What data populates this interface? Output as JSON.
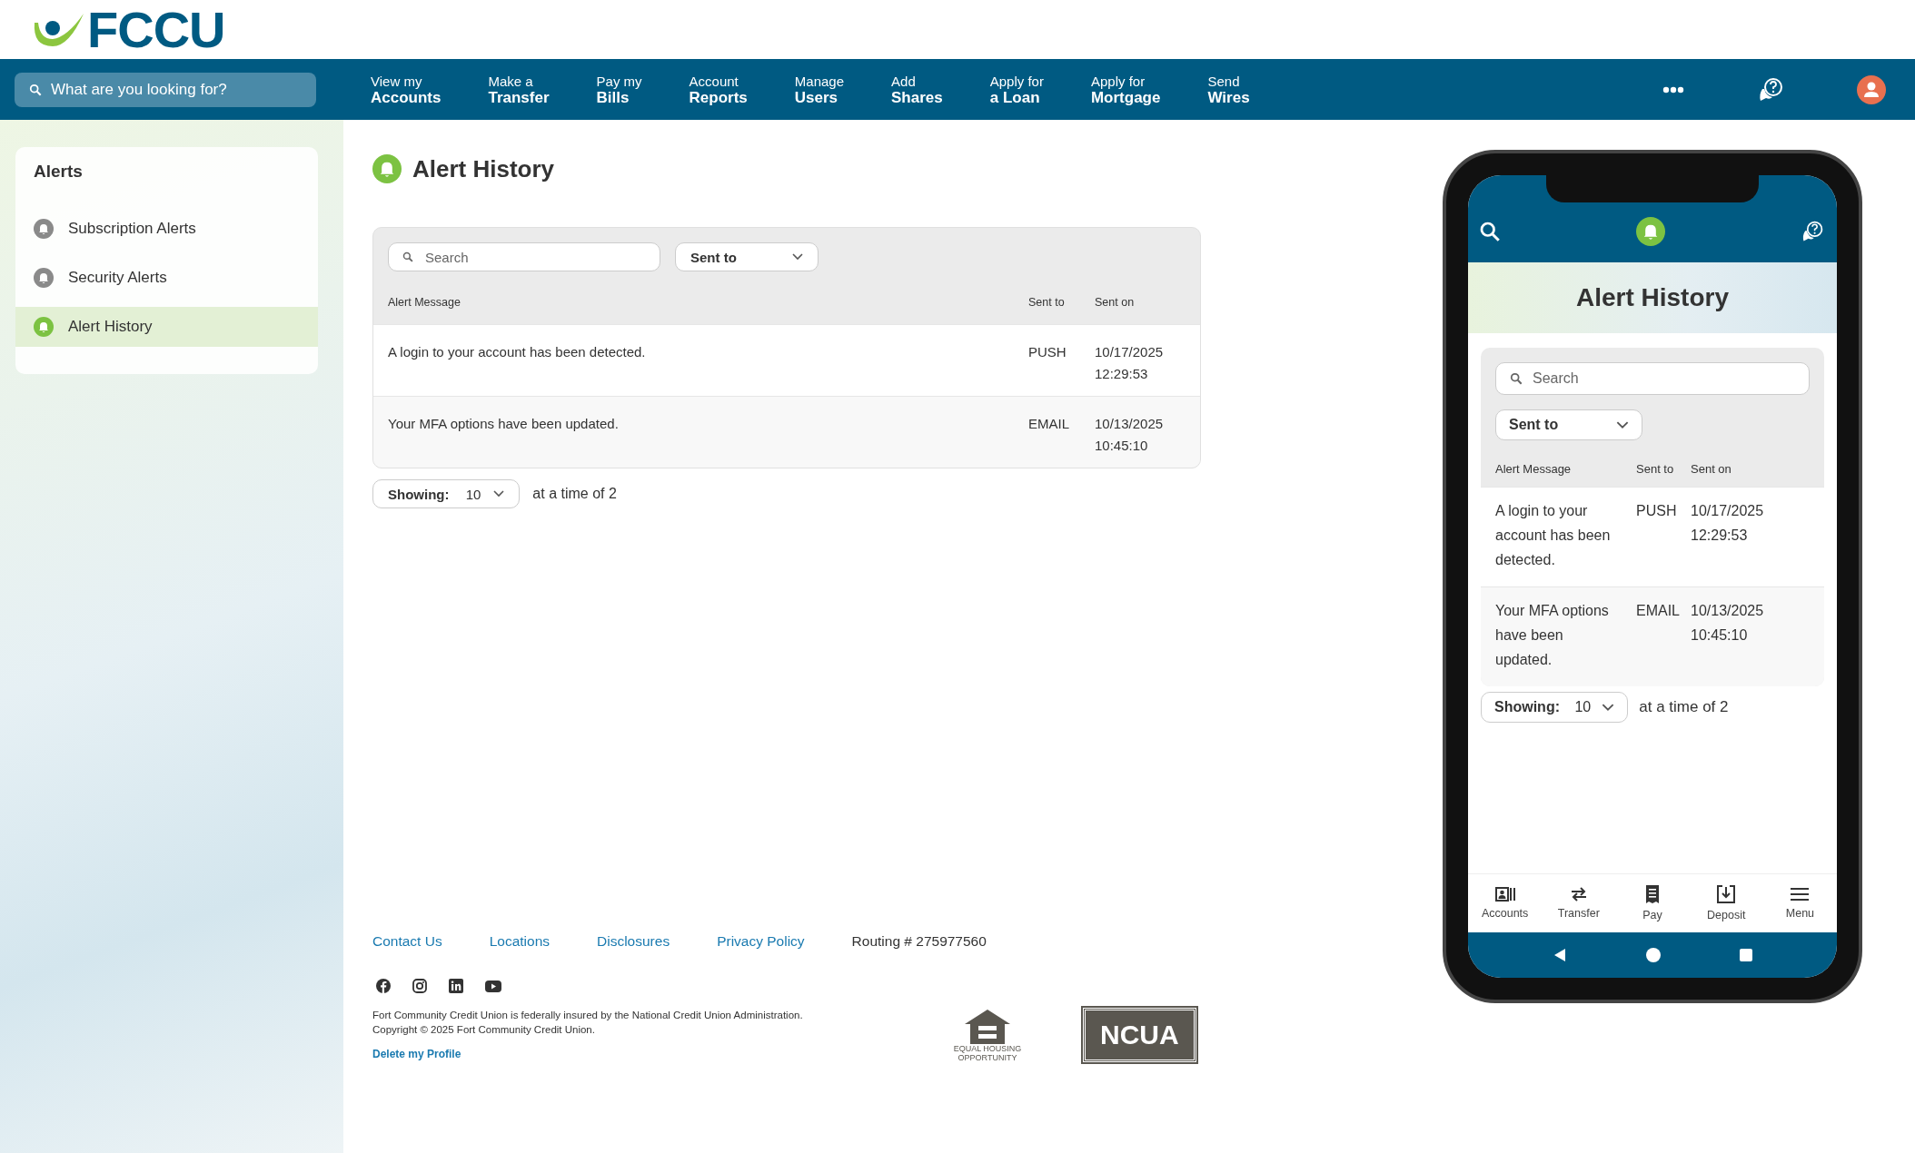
{
  "logo": {
    "text": "FCCU"
  },
  "search": {
    "placeholder": "What are you looking for?"
  },
  "nav": [
    {
      "top": "View my",
      "bottom": "Accounts"
    },
    {
      "top": "Make a",
      "bottom": "Transfer"
    },
    {
      "top": "Pay my",
      "bottom": "Bills"
    },
    {
      "top": "Account",
      "bottom": "Reports"
    },
    {
      "top": "Manage",
      "bottom": "Users"
    },
    {
      "top": "Add",
      "bottom": "Shares"
    },
    {
      "top": "Apply for",
      "bottom": "a Loan"
    },
    {
      "top": "Apply for",
      "bottom": "Mortgage"
    },
    {
      "top": "Send",
      "bottom": "Wires"
    }
  ],
  "sidebar": {
    "title": "Alerts",
    "items": [
      {
        "label": "Subscription Alerts",
        "selected": false
      },
      {
        "label": "Security Alerts",
        "selected": false
      },
      {
        "label": "Alert History",
        "selected": true
      }
    ]
  },
  "page": {
    "title": "Alert History"
  },
  "table": {
    "search_placeholder": "Search",
    "filter": "Sent to",
    "columns": [
      "Alert Message",
      "Sent to",
      "Sent on"
    ],
    "rows": [
      {
        "message": "A login to your account has been detected.",
        "sent_to": "PUSH",
        "sent_on": "10/17/2025 12:29:53"
      },
      {
        "message": "Your MFA options have been updated.",
        "sent_to": "EMAIL",
        "sent_on": "10/13/2025 10:45:10"
      }
    ]
  },
  "pagination": {
    "label": "Showing:",
    "value": "10",
    "suffix": "at a time of 2"
  },
  "footer": {
    "links": [
      "Contact Us",
      "Locations",
      "Disclosures",
      "Privacy Policy"
    ],
    "routing": "Routing # 275977560",
    "social": [
      {
        "kind": "facebook"
      },
      {
        "kind": "instagram"
      },
      {
        "kind": "linkedin"
      },
      {
        "kind": "youtube"
      }
    ],
    "disclaimer": [
      "Fort Community Credit Union is federally insured by the National Credit Union Administration.",
      "Copyright © 2025 Fort Community Credit Union."
    ],
    "delete_link": "Delete my Profile",
    "housing_text": "EQUAL HOUSING OPPORTUNITY",
    "ncua_text": "NCUA"
  },
  "phone": {
    "title": "Alert History",
    "search_placeholder": "Search",
    "filter": "Sent to",
    "columns": [
      "Alert Message",
      "Sent to",
      "Sent on"
    ],
    "rows": [
      {
        "message": "A login to your account has been detected.",
        "sent_to": "PUSH",
        "sent_on": "10/17/2025 12:29:53"
      },
      {
        "message": "Your MFA options have been updated.",
        "sent_to": "EMAIL",
        "sent_on": "10/13/2025 10:45:10"
      }
    ],
    "pagination": {
      "label": "Showing:",
      "value": "10",
      "suffix": "at a time of 2"
    },
    "tabs": [
      {
        "kind": "accounts",
        "label": "Accounts"
      },
      {
        "kind": "transfer",
        "label": "Transfer"
      },
      {
        "kind": "pay",
        "label": "Pay"
      },
      {
        "kind": "deposit",
        "label": "Deposit"
      },
      {
        "kind": "menu",
        "label": "Menu"
      }
    ]
  }
}
